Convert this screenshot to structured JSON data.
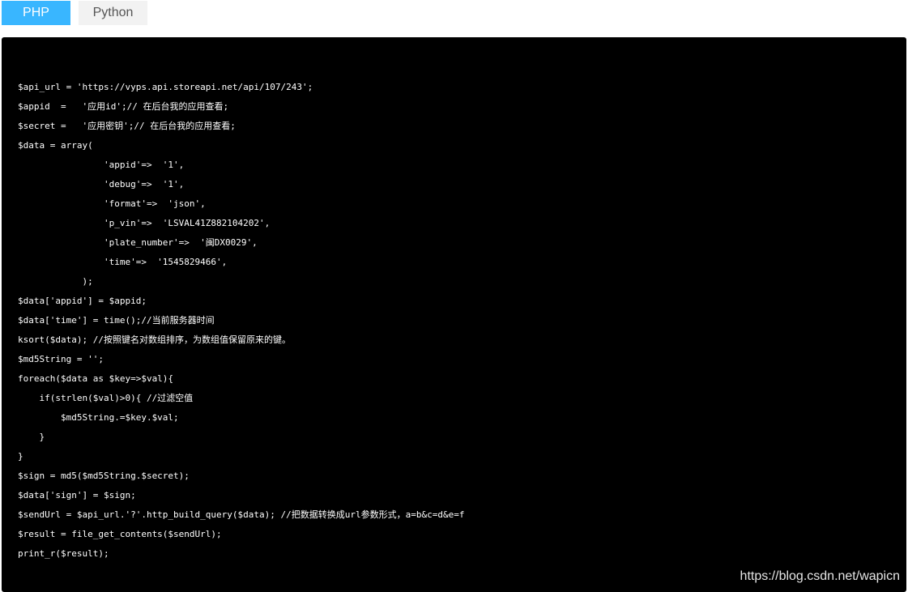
{
  "tabs": [
    {
      "label": "PHP",
      "active": true
    },
    {
      "label": "Python",
      "active": false
    }
  ],
  "code": {
    "lines": [
      "$api_url = 'https://vyps.api.storeapi.net/api/107/243';",
      "$appid  =   '应用id';// 在后台我的应用查看;",
      "$secret =   '应用密钥';// 在后台我的应用查看;",
      "$data = array(",
      "                'appid'=>  '1',",
      "                'debug'=>  '1',",
      "                'format'=>  'json',",
      "                'p_vin'=>  'LSVAL41Z882104202',",
      "                'plate_number'=>  '闽DX0029',",
      "                'time'=>  '1545829466',",
      "            );",
      "$data['appid'] = $appid;",
      "$data['time'] = time();//当前服务器时间",
      "ksort($data); //按照键名对数组排序，为数组值保留原来的键。",
      "$md5String = '';",
      "foreach($data as $key=>$val){",
      "    if(strlen($val)>0){ //过滤空值",
      "        $md5String.=$key.$val;",
      "    }",
      "}",
      "$sign = md5($md5String.$secret);",
      "$data['sign'] = $sign;",
      "$sendUrl = $api_url.'?'.http_build_query($data); //把数据转换成url参数形式，a=b&c=d&e=f",
      "$result = file_get_contents($sendUrl);",
      "print_r($result);"
    ]
  },
  "watermark": "https://blog.csdn.net/wapicn",
  "colors": {
    "tab_active_bg": "#39b6ff",
    "tab_inactive_bg": "#f2f2f2",
    "code_bg": "#000000",
    "code_text": "#ffffff"
  }
}
